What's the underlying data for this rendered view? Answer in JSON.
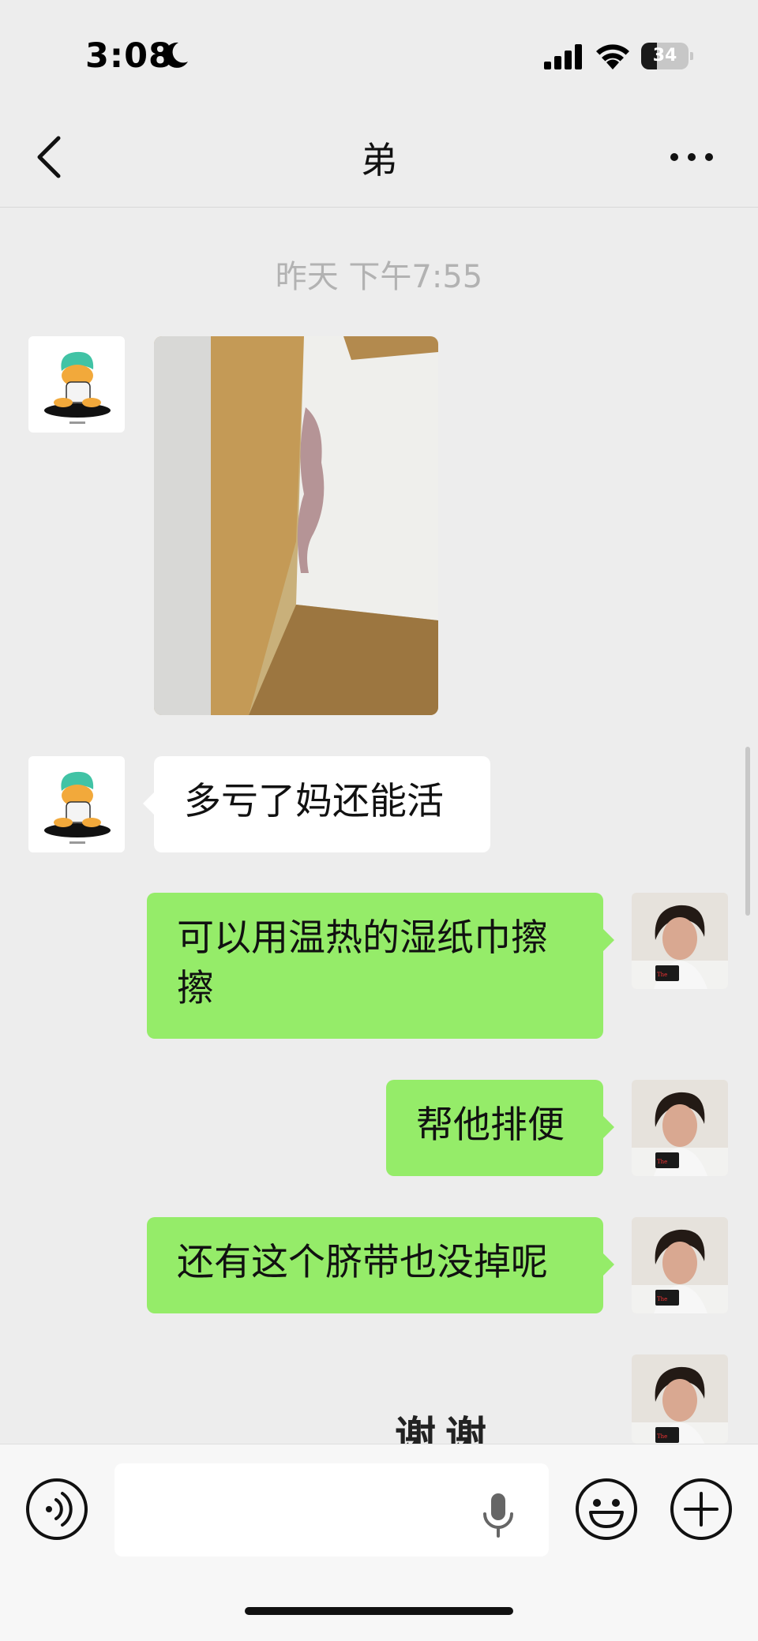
{
  "status_bar": {
    "time": "3:08",
    "battery_level": "34",
    "icons": [
      "moon-icon",
      "signal-icon",
      "wifi-icon",
      "battery-icon"
    ]
  },
  "nav": {
    "title": "弟",
    "back_icon": "chevron-left-icon",
    "more_icon": "more-dots-icon"
  },
  "chat": {
    "timestamp": "昨天 下午7:55",
    "messages": [
      {
        "sender": "contact",
        "type": "image"
      },
      {
        "sender": "contact",
        "type": "text",
        "text": "多亏了妈还能活"
      },
      {
        "sender": "me",
        "type": "text",
        "text": "可以用温热的湿纸巾擦擦"
      },
      {
        "sender": "me",
        "type": "text",
        "text": "帮他排便"
      },
      {
        "sender": "me",
        "type": "text",
        "text": "还有这个脐带也没掉呢"
      },
      {
        "sender": "me",
        "type": "sticker",
        "text": "谢谢"
      }
    ]
  },
  "input_bar": {
    "value": "",
    "icons": [
      "voice-icon",
      "microphone-icon",
      "emoji-icon",
      "plus-icon"
    ]
  },
  "colors": {
    "background": "#ededed",
    "my_bubble": "#95ec69",
    "their_bubble": "#ffffff",
    "timestamp": "#b2b2b2"
  }
}
